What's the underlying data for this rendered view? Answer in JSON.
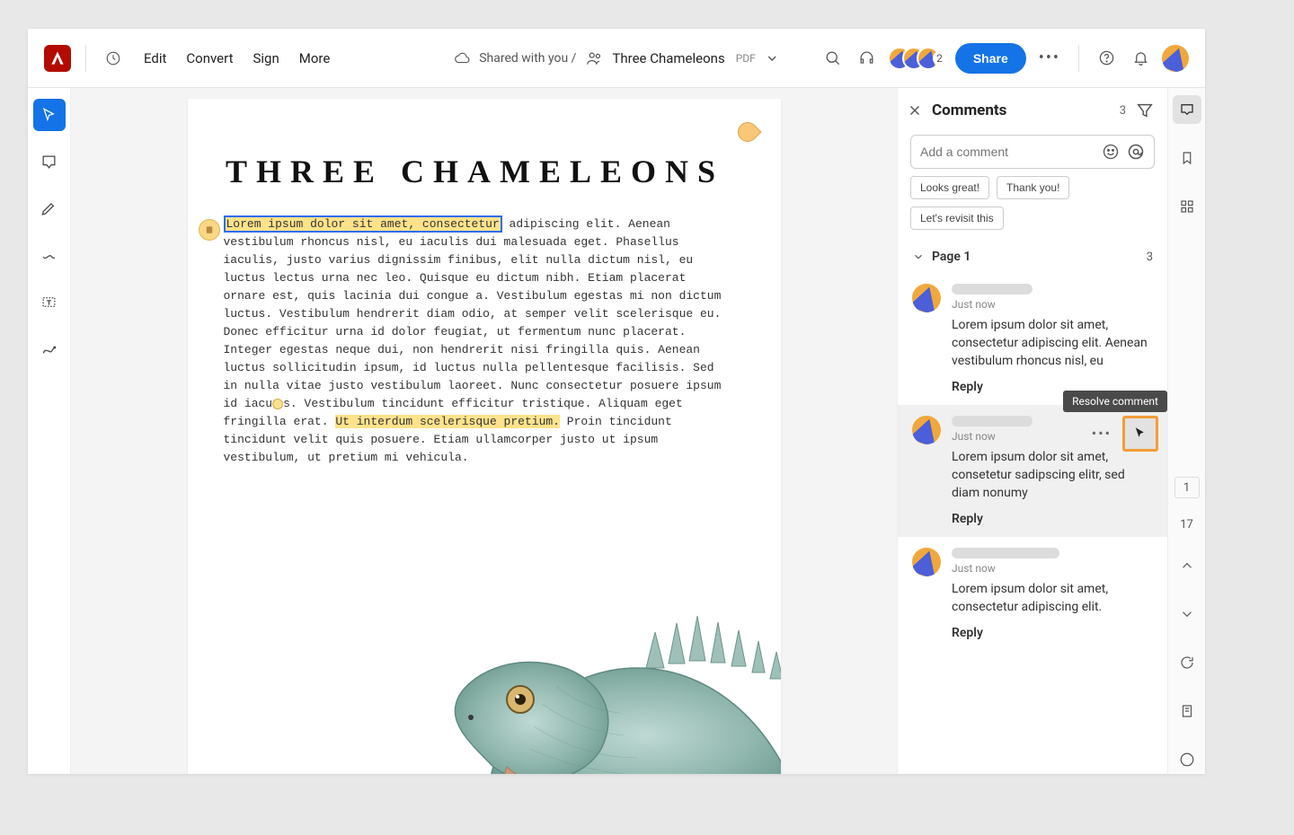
{
  "topbar": {
    "menu": {
      "edit": "Edit",
      "convert": "Convert",
      "sign": "Sign",
      "more": "More"
    },
    "shared_label": "Shared with you /",
    "doc_title": "Three Chameleons",
    "doc_format": "PDF",
    "stack_count": "2",
    "share_button": "Share"
  },
  "document": {
    "heading": "THREE CHAMELEONS",
    "highlighted_selected": "Lorem ipsum dolor sit amet, consectetur",
    "body_segments": {
      "after_sel": " adipiscing elit. Aenean vestibulum rhoncus nisl, eu iaculis dui malesuada eget. Phasellus iaculis, justo varius dignissim finibus, elit nulla dictum nisl, eu luctus lectus urna nec leo. Quisque eu dictum nibh. Etiam placerat ornare est, quis lacinia dui congue a. Vestibulum egestas mi non dictum luctus. Vestibulum hendrerit diam odio, at semper velit scelerisque eu. Donec efficitur urna id dolor feugiat, ut fermentum nunc placerat. Integer egestas neque dui, non hendrerit nisi fringilla quis. Aenean luctus sollicitudin ipsum, id luctus nulla pellentesque facilisis. Sed in nulla vitae justo vestibulum laoreet. Nunc consectetur posuere ipsum id iacu",
      "pre_hl2": "s. Vestibulum tincidunt efficitur tristique. Aliquam eget fringilla erat. ",
      "hl2": "Ut interdum scelerisque pretium.",
      "after_hl2": " Proin tincidunt tincidunt velit quis posuere. Etiam ullamcorper justo ut ipsum vestibulum, ut pretium mi vehicula."
    }
  },
  "comments_panel": {
    "title": "Comments",
    "count": "3",
    "input_placeholder": "Add a comment",
    "quick_replies": [
      "Looks great!",
      "Thank you!",
      "Let's revisit this"
    ],
    "section": {
      "label": "Page 1",
      "count": "3"
    },
    "tooltip_resolve": "Resolve comment",
    "reply_label": "Reply",
    "items": [
      {
        "time": "Just now",
        "text": "Lorem ipsum dolor sit amet, consectetur adipiscing elit. Aenean vestibulum rhoncus nisl, eu"
      },
      {
        "time": "Just now",
        "text": "Lorem ipsum dolor sit amet, consetetur sadipscing elitr, sed diam nonumy"
      },
      {
        "time": "Just now",
        "text": "Lorem ipsum dolor sit amet, consectetur adipiscing elit."
      }
    ]
  },
  "rail": {
    "page_current": "1",
    "page_total": "17"
  }
}
